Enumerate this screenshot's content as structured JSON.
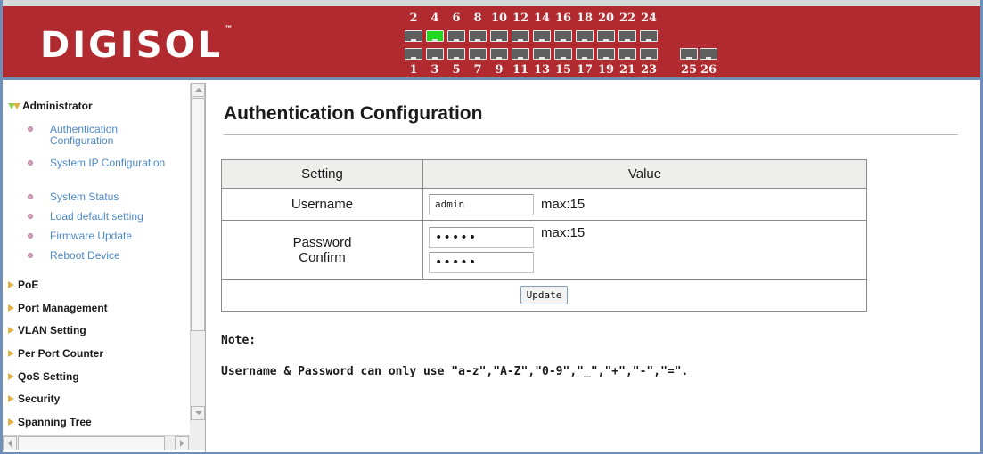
{
  "header": {
    "logo_text": "DIGISOL",
    "logo_tm": "™",
    "ports_top": [
      "2",
      "4",
      "6",
      "8",
      "10",
      "12",
      "14",
      "16",
      "18",
      "20",
      "22",
      "24"
    ],
    "ports_bottom": [
      "1",
      "3",
      "5",
      "7",
      "9",
      "11",
      "13",
      "15",
      "17",
      "19",
      "21",
      "23"
    ],
    "ports_uplink": [
      "25",
      "26"
    ],
    "active_port": "4",
    "colors": {
      "bar": "#b02a2f",
      "active": "#21d71f",
      "inactive": "#5f5f5f"
    }
  },
  "sidebar": {
    "administrator": {
      "label": "Administrator",
      "items": [
        {
          "label": "Authentication Configuration"
        },
        {
          "label": "System IP Configuration"
        },
        {
          "label": "System Status"
        },
        {
          "label": "Load default setting"
        },
        {
          "label": "Firmware Update"
        },
        {
          "label": "Reboot Device"
        }
      ]
    },
    "groups": [
      {
        "label": "PoE"
      },
      {
        "label": "Port Management"
      },
      {
        "label": "VLAN Setting"
      },
      {
        "label": "Per Port Counter"
      },
      {
        "label": "QoS Setting"
      },
      {
        "label": "Security"
      },
      {
        "label": "Spanning Tree"
      }
    ]
  },
  "main": {
    "title": "Authentication Configuration",
    "table": {
      "col_setting": "Setting",
      "col_value": "Value",
      "username_label": "Username",
      "username_value": "admin",
      "username_max": "max:15",
      "password_label": "Password",
      "confirm_label": "Confirm",
      "password_value": "•••••",
      "confirm_value": "•••••",
      "password_max": "max:15",
      "update_button": "Update"
    },
    "note_label": "Note:",
    "note_text": "Username & Password can only use \"a-z\",\"A-Z\",\"0-9\",\"_\",\"+\",\"-\",\"=\"."
  }
}
